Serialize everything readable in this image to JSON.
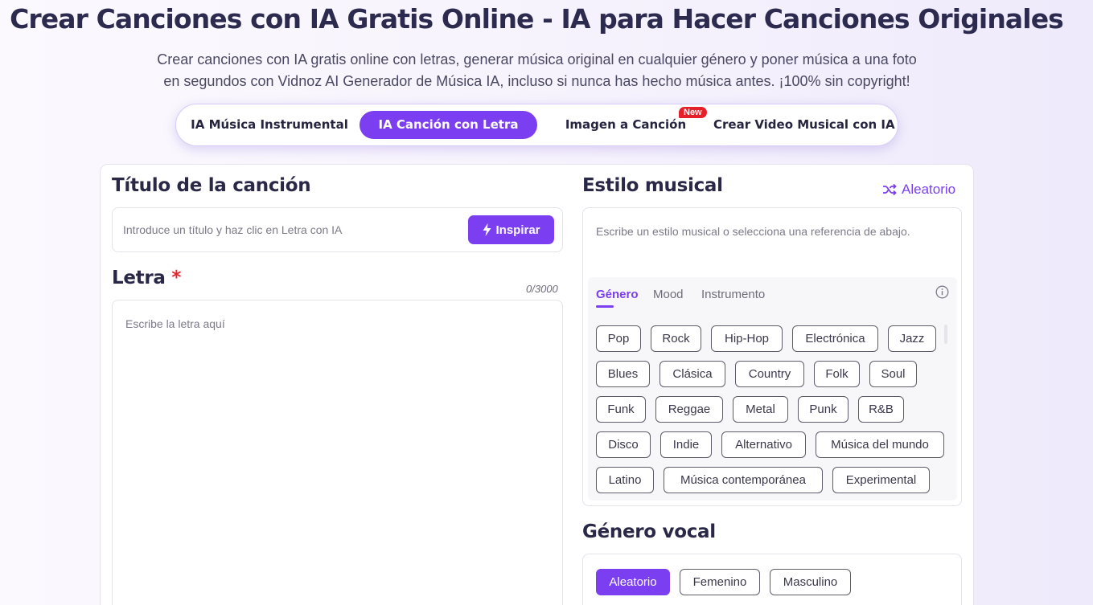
{
  "header": {
    "title": "Crear Canciones con IA Gratis Online - IA para Hacer Canciones Originales",
    "subtitle_line1": "Crear canciones con IA gratis online con letras, generar música original en cualquier género y poner música a una foto",
    "subtitle_line2": "en segundos con Vidnoz AI Generador de Música IA, incluso si nunca has hecho música antes. ¡100% sin copyright!"
  },
  "mode_tabs": [
    {
      "label": "IA Música Instrumental",
      "active": false
    },
    {
      "label": "IA Canción con Letra",
      "active": true
    },
    {
      "label": "Imagen a Canción",
      "active": false,
      "badge": "New"
    },
    {
      "label": "Crear Video Musical con IA",
      "active": false
    }
  ],
  "song_title": {
    "heading": "Título de la canción",
    "placeholder": "Introduce un título y haz clic en Letra con IA",
    "inspire_label": "Inspirar",
    "inspire_icon": "lightning-bolt-icon"
  },
  "lyrics": {
    "heading": "Letra",
    "required_mark": "*",
    "counter": "0/3000",
    "placeholder": "Escribe la letra aquí"
  },
  "music_style": {
    "heading": "Estilo musical",
    "random_label": "Aleatorio",
    "random_icon": "shuffle-icon",
    "placeholder": "Escribe un estilo musical o selecciona una referencia de abajo.",
    "subtabs": [
      "Género",
      "Mood",
      "Instrumento"
    ],
    "active_subtab": "Género",
    "info_icon": "info-icon",
    "genres": [
      "Pop",
      "Rock",
      "Hip-Hop",
      "Electrónica",
      "Jazz",
      "Blues",
      "Clásica",
      "Country",
      "Folk",
      "Soul",
      "Funk",
      "Reggae",
      "Metal",
      "Punk",
      "R&B",
      "Disco",
      "Indie",
      "Alternativo",
      "Música del mundo",
      "Latino",
      "Música contemporánea",
      "Experimental"
    ]
  },
  "vocal_gender": {
    "heading": "Género vocal",
    "options": [
      "Aleatorio",
      "Femenino",
      "Masculino"
    ],
    "selected": "Aleatorio"
  },
  "colors": {
    "accent": "#7b3ff1",
    "heading_text": "#2a2847",
    "new_badge": "#e5202a"
  }
}
